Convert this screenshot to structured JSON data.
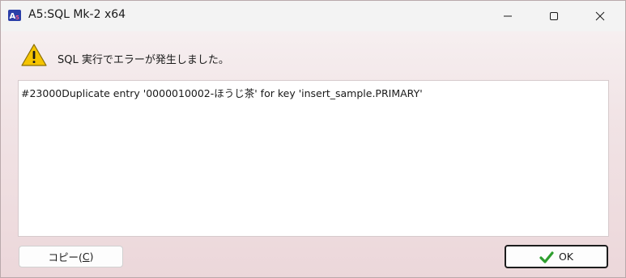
{
  "window": {
    "title": "A5:SQL Mk-2 x64"
  },
  "title_buttons": {
    "minimize": "minimize-icon",
    "maximize": "maximize-icon",
    "close": "close-icon"
  },
  "dialog": {
    "message": "SQL 実行でエラーが発生しました。",
    "detail": "#23000Duplicate entry '0000010002-ほうじ茶' for key 'insert_sample.PRIMARY'",
    "icon": "warning-icon"
  },
  "buttons": {
    "copy_label_prefix": "コピー(",
    "copy_label_key": "C",
    "copy_label_suffix": ")",
    "ok_label": "OK",
    "ok_icon": "check-icon"
  },
  "colors": {
    "warning": "#f5c400",
    "check": "#2e9e2e"
  }
}
